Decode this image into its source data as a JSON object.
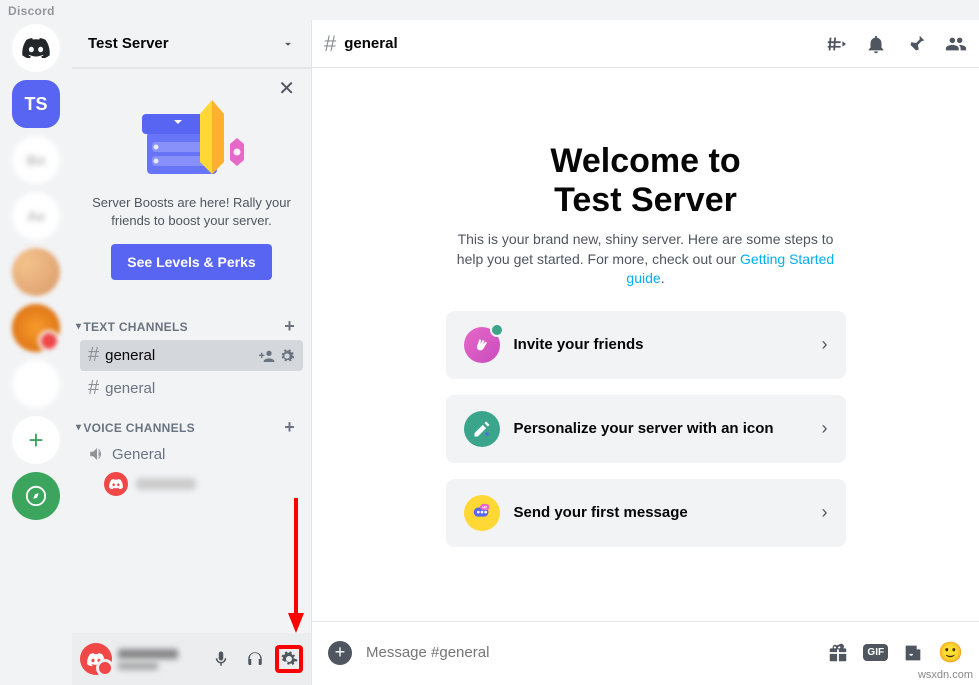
{
  "titlebar": "Discord",
  "server_list": {
    "selected_initials": "TS",
    "add_label": "+"
  },
  "server_header": {
    "name": "Test Server"
  },
  "boost_card": {
    "text": "Server Boosts are here! Rally your friends to boost your server.",
    "button": "See Levels & Perks"
  },
  "categories": {
    "text": {
      "label": "TEXT CHANNELS"
    },
    "voice": {
      "label": "VOICE CHANNELS"
    }
  },
  "channels": {
    "general_sel": "general",
    "general2": "general",
    "voice_general": "General"
  },
  "chat_header": {
    "title": "general"
  },
  "welcome": {
    "title_line1": "Welcome to",
    "title_line2": "Test Server",
    "subtitle_pre": "This is your brand new, shiny server. Here are some steps to help you get started. For more, check out our ",
    "subtitle_link": "Getting Started guide",
    "subtitle_post": "."
  },
  "actions": {
    "invite": "Invite your friends",
    "personalize": "Personalize your server with an icon",
    "first_msg": "Send your first message"
  },
  "chat_input": {
    "placeholder": "Message #general",
    "gif": "GIF"
  },
  "watermark": "wsxdn.com"
}
